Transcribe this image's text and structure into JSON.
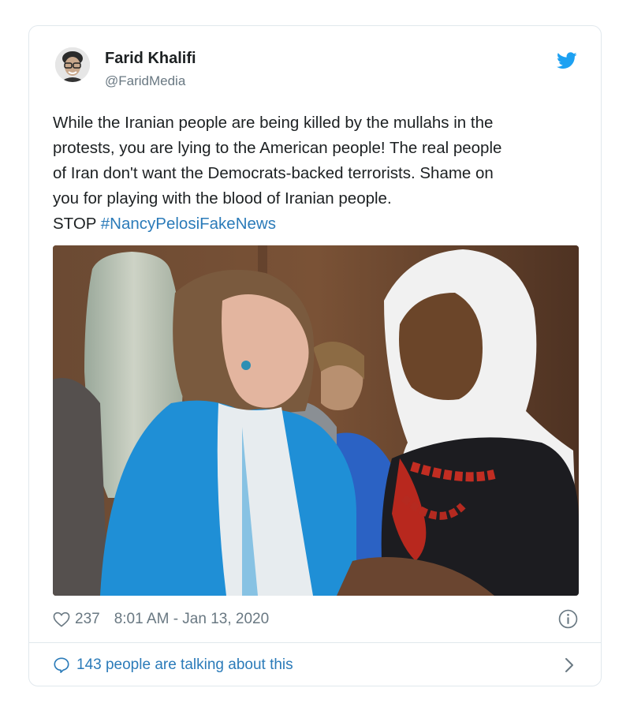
{
  "tweet": {
    "author_name": "Farid Khalifi",
    "author_handle": "@FaridMedia",
    "text_lines": [
      "While the Iranian people are being killed by the mullahs in the",
      "protests, you are lying to the American people! The real people",
      "of Iran don't want the Democrats-backed terrorists. Shame on",
      "you for playing with the blood of Iranian people."
    ],
    "text_tail": "STOP ",
    "hashtag": "#NancyPelosiFakeNews",
    "likes": "237",
    "timestamp": "8:01 AM - Jan 13, 2020",
    "talking": "143 people are talking about this"
  },
  "icons": {
    "avatar": "avatar-icon",
    "brand": "twitter-bird-icon",
    "like": "heart-icon",
    "info": "info-icon",
    "reply": "speech-bubble-icon",
    "more": "chevron-right-icon"
  },
  "colors": {
    "link": "#2b7bb9",
    "brand": "#1da1f2",
    "muted": "#697882",
    "text": "#1c2022",
    "border": "#e1e8ed"
  }
}
